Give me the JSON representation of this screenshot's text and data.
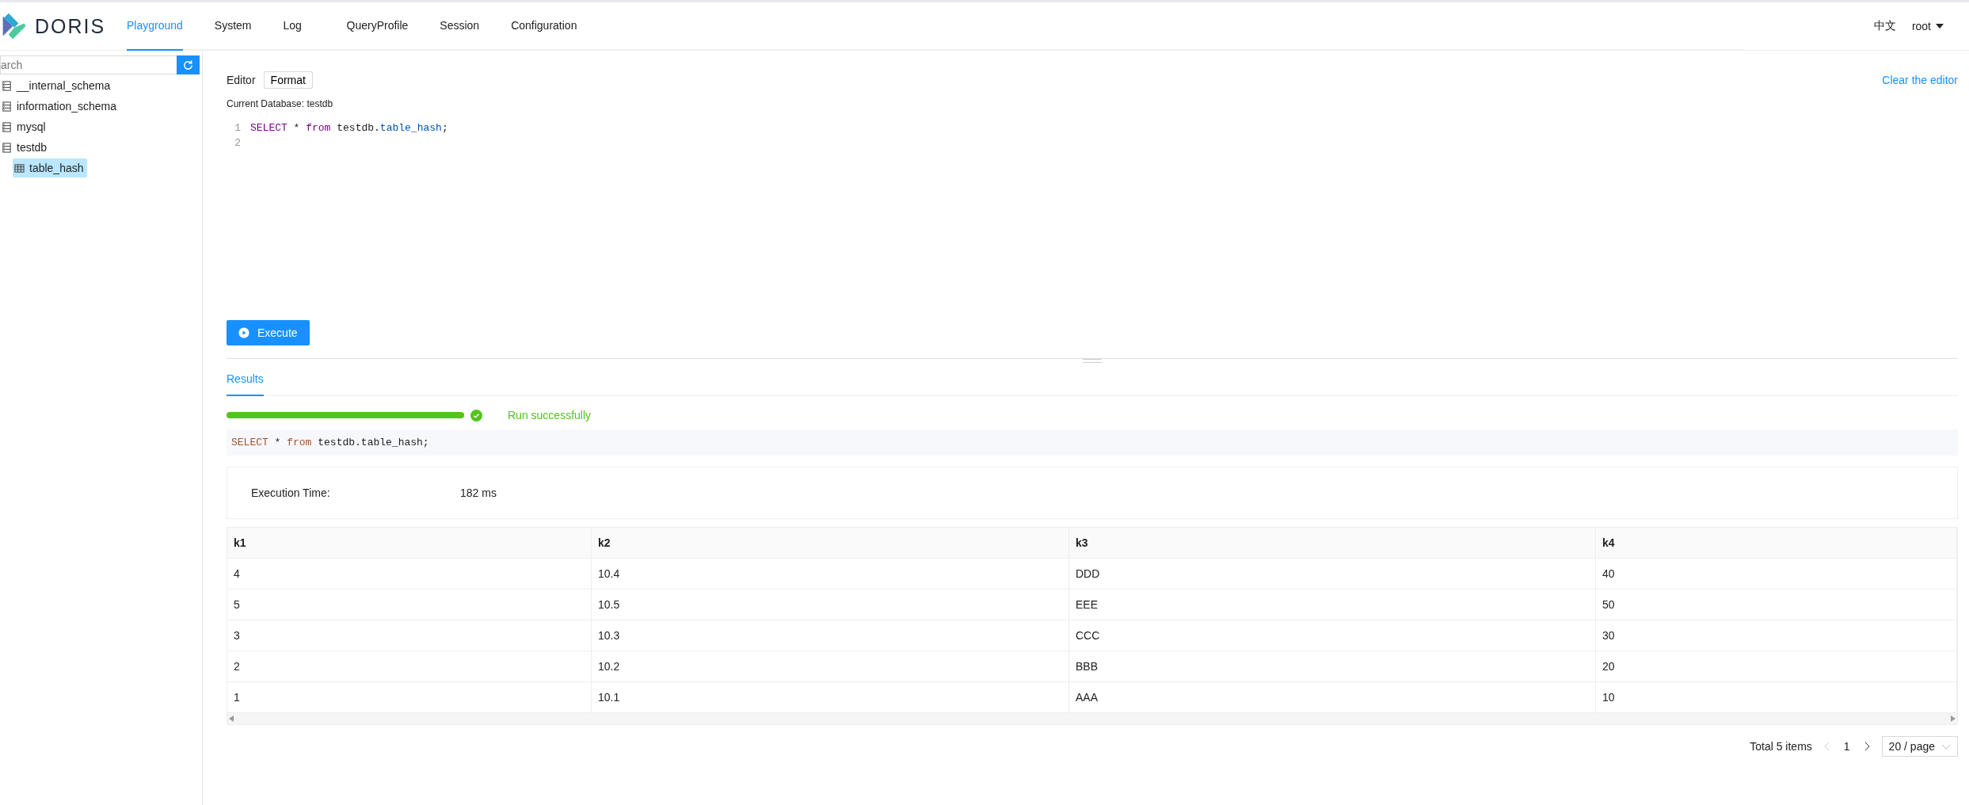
{
  "header": {
    "logo": "DORIS",
    "nav": [
      {
        "label": "Playground",
        "selected": true
      },
      {
        "label": "System",
        "selected": false
      },
      {
        "label": "Log",
        "selected": false
      },
      {
        "label": "QueryProfile",
        "selected": false
      },
      {
        "label": "Session",
        "selected": false
      },
      {
        "label": "Configuration",
        "selected": false
      }
    ],
    "language": "中文",
    "user": "root"
  },
  "sidebar": {
    "search": {
      "placeholder": "arch"
    },
    "tree": [
      {
        "label": "__internal_schema",
        "kind": "database",
        "selected": false
      },
      {
        "label": "information_schema",
        "kind": "database",
        "selected": false
      },
      {
        "label": "mysql",
        "kind": "database",
        "selected": false
      },
      {
        "label": "testdb",
        "kind": "database",
        "selected": false,
        "children": [
          {
            "label": "table_hash",
            "kind": "table",
            "selected": true
          }
        ]
      }
    ]
  },
  "editor": {
    "label": "Editor",
    "format_button": "Format",
    "clear_link": "Clear the editor",
    "current_database": "Current Database: testdb",
    "lines": [
      {
        "number": "1",
        "tokens": [
          {
            "text": "SELECT",
            "kind": "keyword"
          },
          {
            "text": " * ",
            "kind": "plain"
          },
          {
            "text": "from",
            "kind": "keyword"
          },
          {
            "text": " testdb.",
            "kind": "plain"
          },
          {
            "text": "table_hash",
            "kind": "identifier"
          },
          {
            "text": ";",
            "kind": "plain"
          }
        ]
      },
      {
        "number": "2"
      }
    ],
    "execute_button": "Execute"
  },
  "results": {
    "tabs": [
      {
        "label": "Results",
        "selected": true
      }
    ],
    "progress": {
      "level": 1,
      "status": "Run successfully"
    },
    "query": [
      {
        "text": "SELECT",
        "kind": "keyword"
      },
      {
        "text": " * ",
        "kind": "plain"
      },
      {
        "text": "from",
        "kind": "keyword"
      },
      {
        "text": " testdb.table_hash;",
        "kind": "plain"
      }
    ],
    "execution_time": {
      "label": "Execution Time:",
      "value": "182 ms"
    },
    "table": {
      "columns": [
        "k1",
        "k2",
        "k3",
        "k4"
      ],
      "rows": [
        [
          "4",
          "10.4",
          "DDD",
          "40"
        ],
        [
          "5",
          "10.5",
          "EEE",
          "50"
        ],
        [
          "3",
          "10.3",
          "CCC",
          "30"
        ],
        [
          "2",
          "10.2",
          "BBB",
          "20"
        ],
        [
          "1",
          "10.1",
          "AAA",
          "10"
        ]
      ]
    },
    "pagination": {
      "total": "Total 5 items",
      "pages": [
        {
          "label": "1",
          "selected": true
        }
      ],
      "page_size": "20 / page"
    }
  }
}
